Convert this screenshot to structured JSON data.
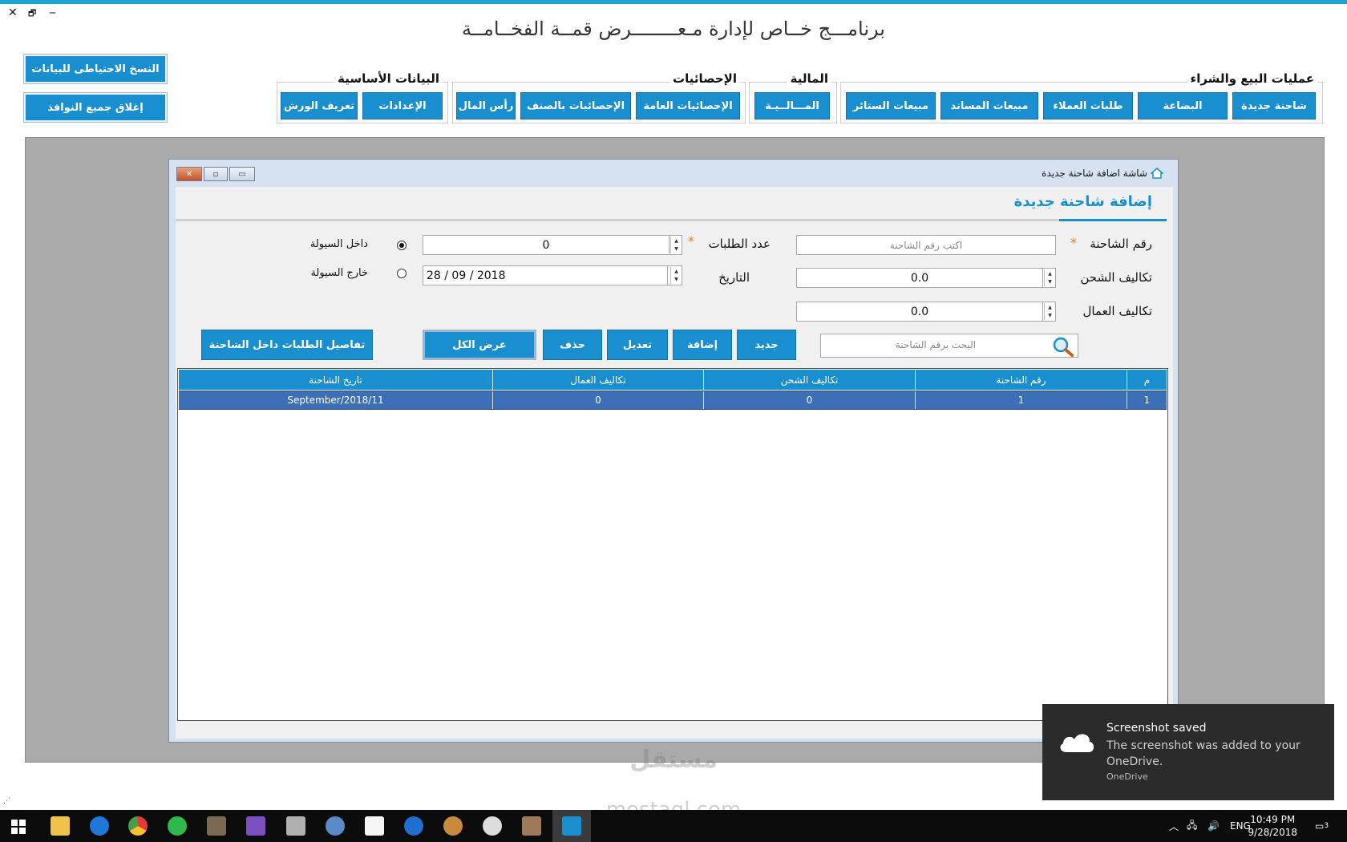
{
  "window": {
    "close_glyph": "✕",
    "restore_glyph": "🗗",
    "minimize_glyph": "‒",
    "title": "برنامـــج   خــاص لإدارة مـعــــــــرض قمــة الفخــامــة"
  },
  "side_buttons": {
    "backup": "النسخ الاحتياطى للبيانات",
    "close_all": "إغلاق جميع النوافذ"
  },
  "menu_groups": {
    "sales": {
      "title": "عمليات البيع والشراء",
      "items": [
        "شاحنة جديدة",
        "البضاعة",
        "طلبات العملاء",
        "مبيعات المساند",
        "مبيعات الستائر"
      ]
    },
    "finance": {
      "title": "المالية",
      "items": [
        "المـــالــيـة"
      ]
    },
    "stats": {
      "title": "الإحصائيات",
      "items": [
        "الإحصائيات العامة",
        "الإحصائيات بالصنف",
        "رأس المال"
      ]
    },
    "basic": {
      "title": "البيانات الأساسية",
      "items": [
        "الإعدادات",
        "تعريف الورش"
      ]
    }
  },
  "child_window": {
    "title": "شاشة اضافة شاحنة جديدة",
    "heading": "إضافة شاحنة جديدة",
    "fields": {
      "truck_no_label": "رقم الشاحنة",
      "truck_no_placeholder": "اكتب رقم الشاحنة",
      "shipping_cost_label": "تكاليف الشحن",
      "shipping_cost_value": "0.0",
      "labor_cost_label": "تكاليف العمال",
      "labor_cost_value": "0.0",
      "orders_count_label": "عدد الطلبات",
      "orders_count_value": "0",
      "date_label": "التاريخ",
      "date_value": "28 / 09 / 2018",
      "inside_label": "داخل السيولة",
      "outside_label": "خارج السيولة",
      "selected_radio": "inside",
      "required_mark": "*"
    },
    "actions": {
      "new": "جديد",
      "add": "إضافة",
      "edit": "تعديل",
      "delete": "حذف",
      "show_all": "عرض الكل",
      "order_details": "تفاصيل الطلبات داخل الشاحنة",
      "search_placeholder": "البحث برقم الشاحنة"
    },
    "table": {
      "columns": [
        "م",
        "رقم الشاحنة",
        "تكاليف الشحن",
        "تكاليف العمال",
        "تاريخ الشاحنة"
      ],
      "rows": [
        [
          "1",
          "1",
          "0",
          "0",
          "September/2018/11"
        ]
      ]
    }
  },
  "toast": {
    "title": "Screenshot saved",
    "message": "The screenshot was added to your OneDrive.",
    "source": "OneDrive"
  },
  "watermark": {
    "ar": "مستقل",
    "en": "mostaql.com"
  },
  "taskbar": {
    "language": "ENG",
    "time": "10:49 PM",
    "date": "9/28/2018",
    "notifications_count": "3"
  },
  "colors": {
    "accent": "#1a8fd0",
    "titlebar": "#1ca3d8",
    "selected_row": "#3c6fb6",
    "required": "#e67e22"
  }
}
